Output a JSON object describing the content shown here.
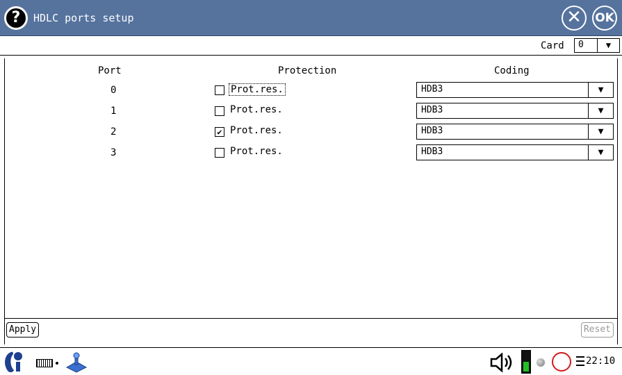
{
  "window": {
    "title": "HDLC ports setup",
    "help_glyph": "?",
    "close_glyph": "✕",
    "ok_label": "OK"
  },
  "card": {
    "label": "Card",
    "value": "0",
    "arrow": "▼"
  },
  "table": {
    "headers": {
      "port": "Port",
      "protection": "Protection",
      "coding": "Coding"
    },
    "rows": [
      {
        "port": "0",
        "checked": false,
        "check_glyph": "",
        "protection_label": "Prot.res.",
        "coding": "HDB3",
        "arrow": "▼"
      },
      {
        "port": "1",
        "checked": false,
        "check_glyph": "",
        "protection_label": "Prot.res.",
        "coding": "HDB3",
        "arrow": "▼"
      },
      {
        "port": "2",
        "checked": true,
        "check_glyph": "✔",
        "protection_label": "Prot.res.",
        "coding": "HDB3",
        "arrow": "▼"
      },
      {
        "port": "3",
        "checked": false,
        "check_glyph": "",
        "protection_label": "Prot.res.",
        "coding": "HDB3",
        "arrow": "▼"
      }
    ]
  },
  "buttons": {
    "apply": "Apply",
    "reset": "Reset"
  },
  "taskbar": {
    "clock": "22:10",
    "icons": [
      "start-icon",
      "keyboard-icon",
      "joystick-icon",
      "speaker-icon",
      "battery-icon",
      "status-led-icon",
      "power-ring-icon",
      "network-icon"
    ]
  },
  "colors": {
    "titlebar": "#56739e",
    "battery_fill": "#22c022",
    "ring": "#d21b1b",
    "disabled": "#9a9a9a"
  }
}
